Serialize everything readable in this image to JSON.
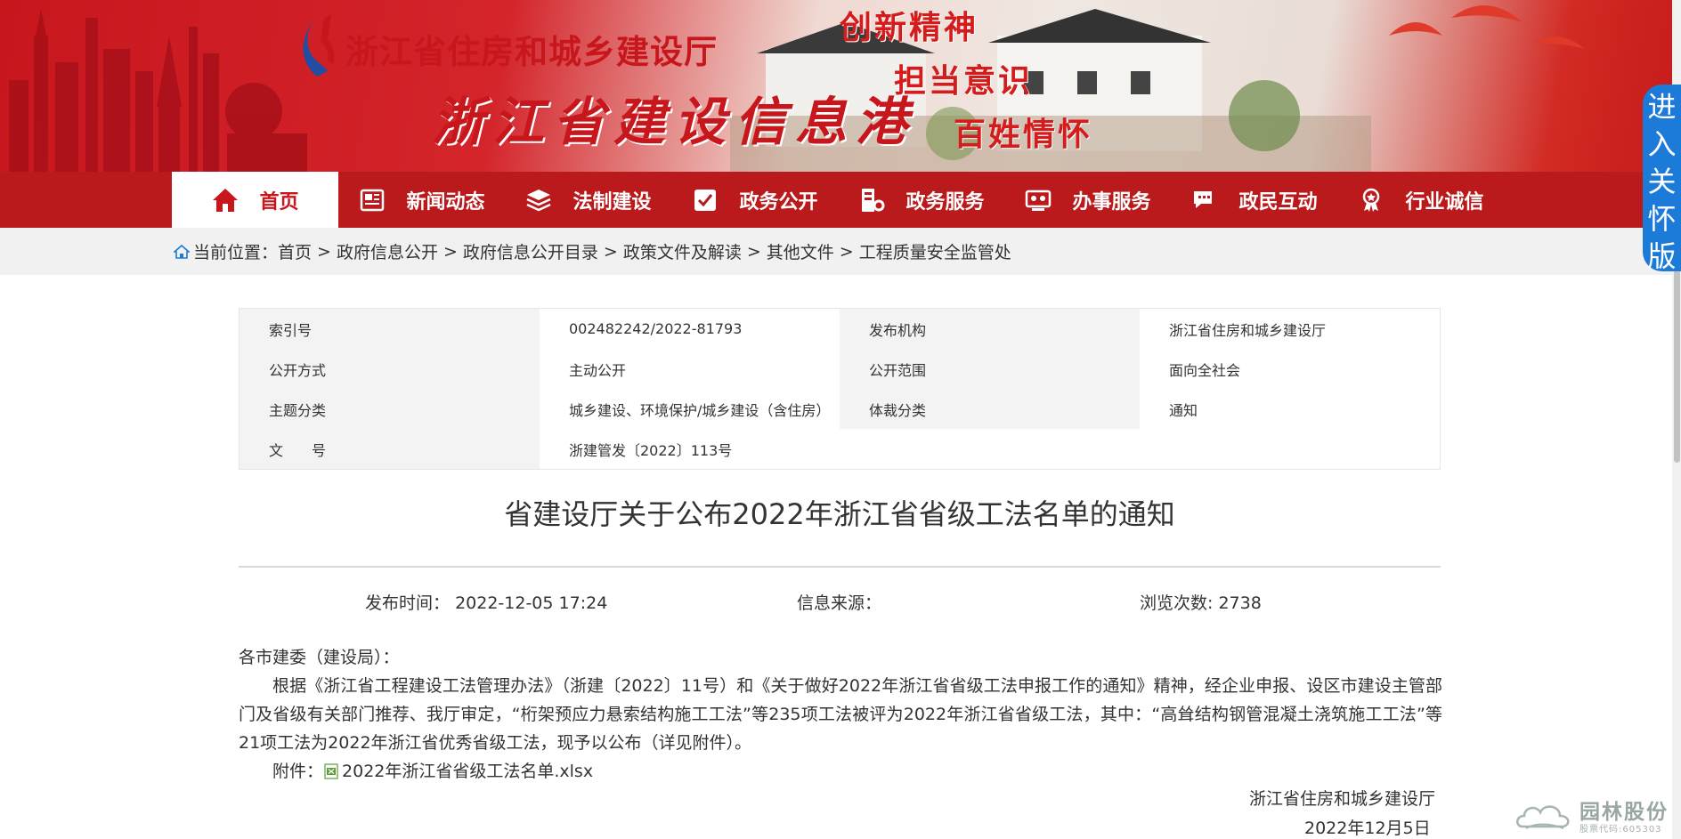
{
  "banner": {
    "org_title": "浙江省住房和城乡建设厅",
    "site_title": "浙江省建设信息港",
    "slogans": [
      "创新精神",
      "担当意识",
      "百姓情怀"
    ]
  },
  "elder_mode": {
    "chars": [
      "进",
      "入",
      "关",
      "怀",
      "版"
    ]
  },
  "nav": {
    "items": [
      {
        "label": "首页",
        "icon": "home-icon"
      },
      {
        "label": "新闻动态",
        "icon": "newspaper-icon"
      },
      {
        "label": "法制建设",
        "icon": "stack-icon"
      },
      {
        "label": "政务公开",
        "icon": "check-board-icon"
      },
      {
        "label": "政务服务",
        "icon": "service-gear-icon"
      },
      {
        "label": "办事服务",
        "icon": "monitor-icon"
      },
      {
        "label": "政民互动",
        "icon": "chat-icon"
      },
      {
        "label": "行业诚信",
        "icon": "medal-icon"
      }
    ]
  },
  "breadcrumb": {
    "prefix": "当前位置：",
    "items": [
      "首页",
      "政府信息公开",
      "政府信息公开目录",
      "政策文件及解读",
      "其他文件",
      "工程质量安全监管处"
    ],
    "separator": ">"
  },
  "meta": {
    "rows": [
      [
        {
          "type": "label",
          "text": "索引号"
        },
        {
          "type": "value",
          "text": "002482242/2022-81793"
        },
        {
          "type": "label",
          "text": "发布机构"
        },
        {
          "type": "value",
          "text": "浙江省住房和城乡建设厅"
        }
      ],
      [
        {
          "type": "label",
          "text": "公开方式"
        },
        {
          "type": "value",
          "text": "主动公开"
        },
        {
          "type": "label",
          "text": "公开范围"
        },
        {
          "type": "value",
          "text": "面向全社会"
        }
      ],
      [
        {
          "type": "label",
          "text": "主题分类"
        },
        {
          "type": "value",
          "text": "城乡建设、环境保护/城乡建设（含住房）"
        },
        {
          "type": "label",
          "text": "体裁分类"
        },
        {
          "type": "value",
          "text": "通知"
        }
      ],
      [
        {
          "type": "label",
          "text": "文　　号"
        },
        {
          "type": "value",
          "text": "浙建管发〔2022〕113号"
        },
        {
          "type": "value",
          "text": ""
        },
        {
          "type": "value",
          "text": ""
        }
      ]
    ]
  },
  "article": {
    "title": "省建设厅关于公布2022年浙江省省级工法名单的通知",
    "publish_time_label": "发布时间：",
    "publish_time": "2022-12-05 17:24",
    "source_label": "信息来源：",
    "source": "",
    "views_label": "浏览次数:",
    "views": "2738",
    "salutation": "各市建委（建设局）：",
    "paragraph": "根据《浙江省工程建设工法管理办法》（浙建〔2022〕11号）和《关于做好2022年浙江省省级工法申报工作的通知》精神，经企业申报、设区市建设主管部门及省级有关部门推荐、我厅审定，“桁架预应力悬索结构施工工法”等235项工法被评为2022年浙江省省级工法，其中：“高耸结构钢管混凝土浇筑施工工法”等21项工法为2022年浙江省优秀省级工法，现予以公布（详见附件）。",
    "attachment_label": "附件：",
    "attachment_name": "2022年浙江省省级工法名单.xlsx",
    "signature": "浙江省住房和城乡建设厅",
    "date": "2022年12月5日"
  },
  "watermark": {
    "name": "园林股份",
    "code": "股票代码:605303"
  },
  "colors": {
    "brand_red": "#c8161d",
    "nav_red": "#ba1a1c",
    "elder_blue": "#1c7ad9"
  }
}
